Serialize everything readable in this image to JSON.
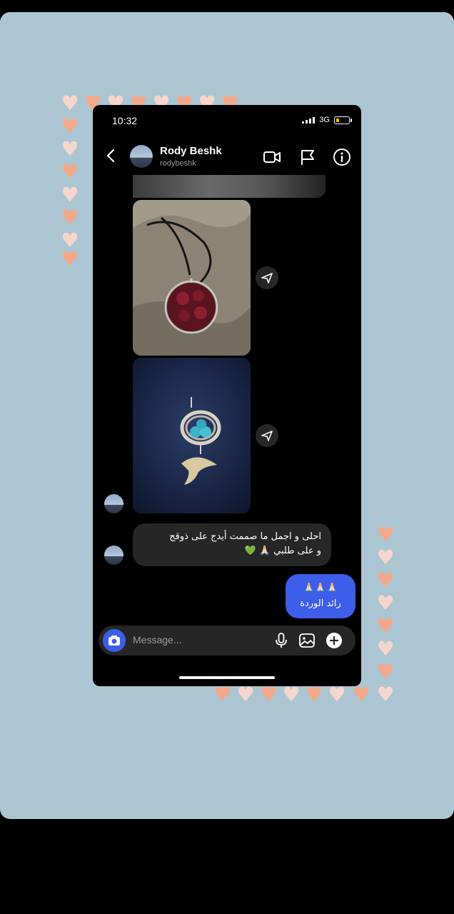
{
  "status": {
    "time": "10:32",
    "network": "3G"
  },
  "header": {
    "name": "Rody Beshk",
    "handle": "rodybeshk"
  },
  "icons": {
    "back": "chevron-left-icon",
    "video": "video-camera-icon",
    "flag": "flag-icon",
    "info": "info-icon",
    "share": "paper-plane-icon",
    "camera": "camera-icon",
    "mic": "microphone-icon",
    "gallery": "image-icon",
    "add": "plus-circle-icon"
  },
  "messages": {
    "incoming_line1": "احلى و اجمل ما صممت أيدج على ذوقج",
    "incoming_line2": "و على طلبي 🙏🏻 💚",
    "outgoing_line1": "🙏🏻🙏🏻🙏🏻",
    "outgoing_line2": "رائد الوردة"
  },
  "composer": {
    "placeholder": "Message..."
  },
  "colors": {
    "background": "#abc6d2",
    "accent": "#3d5ee8",
    "bubble_in": "#262626",
    "heart_peach": "#f4a98b",
    "heart_light": "#f6d6cc"
  }
}
